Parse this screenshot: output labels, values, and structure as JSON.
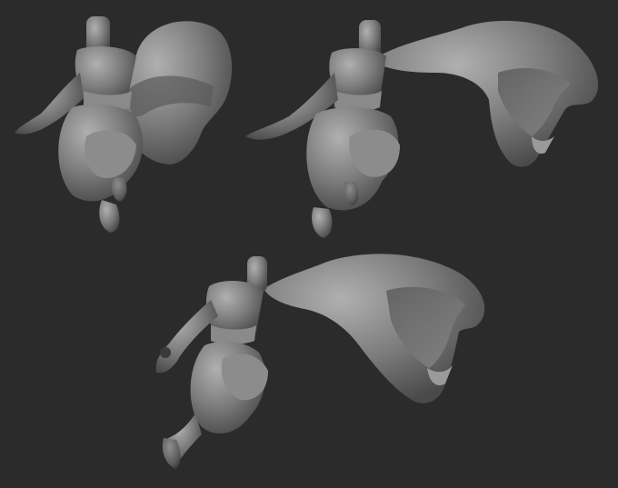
{
  "scene": {
    "background_color": "#2b2b2b",
    "material_colors": {
      "base": "#7a7a7a",
      "light": "#a9a9a9",
      "dark": "#3a3a3a",
      "mid": "#5c5c5c"
    },
    "views": [
      {
        "name": "pose-front"
      },
      {
        "name": "pose-three-quarter"
      },
      {
        "name": "pose-side"
      }
    ]
  }
}
